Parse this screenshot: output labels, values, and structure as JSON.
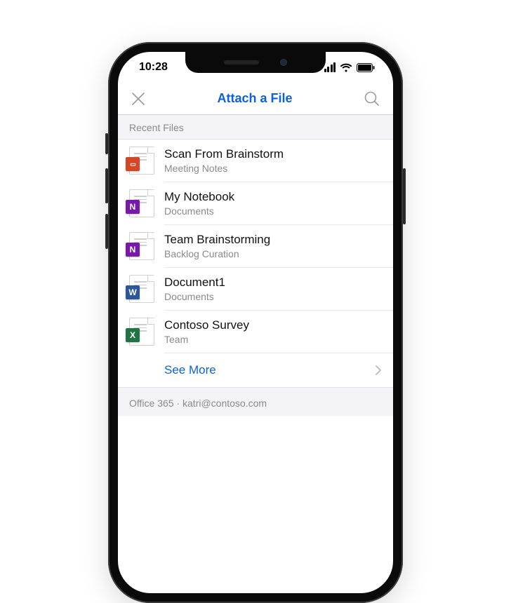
{
  "status": {
    "time": "10:28"
  },
  "nav": {
    "title": "Attach a File"
  },
  "sections": {
    "recent": {
      "label": "Recent Files",
      "see_more": "See More"
    },
    "account": {
      "provider": "Office 365",
      "email": "katri@contoso.com",
      "separator": " · "
    }
  },
  "files": [
    {
      "title": "Scan From Brainstorm",
      "subtitle": "Meeting Notes",
      "icon": "powerpoint"
    },
    {
      "title": "My Notebook",
      "subtitle": "Documents",
      "icon": "onenote"
    },
    {
      "title": "Team Brainstorming",
      "subtitle": "Backlog Curation",
      "icon": "onenote"
    },
    {
      "title": "Document1",
      "subtitle": "Documents",
      "icon": "word"
    },
    {
      "title": "Contoso Survey",
      "subtitle": "Team",
      "icon": "excel"
    }
  ],
  "icon_letters": {
    "powerpoint": "▭",
    "onenote": "N",
    "word": "W",
    "excel": "X"
  }
}
